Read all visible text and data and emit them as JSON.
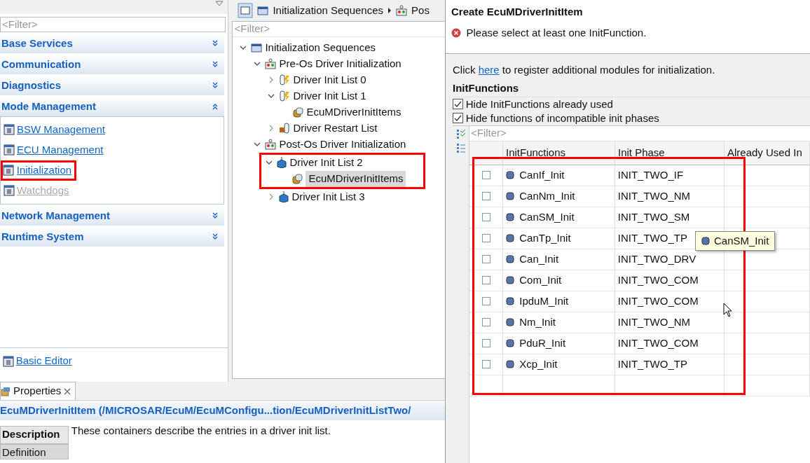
{
  "left_panel": {
    "filter_placeholder": "<Filter>",
    "sections": [
      {
        "label": "Base Services",
        "expanded": false
      },
      {
        "label": "Communication",
        "expanded": false
      },
      {
        "label": "Diagnostics",
        "expanded": false
      },
      {
        "label": "Mode Management",
        "expanded": true,
        "items": [
          {
            "label": "BSW Management",
            "disabled": false,
            "annotated": false
          },
          {
            "label": "ECU Management",
            "disabled": false,
            "annotated": false
          },
          {
            "label": "Initialization",
            "disabled": false,
            "annotated": true
          },
          {
            "label": "Watchdogs",
            "disabled": true,
            "annotated": false
          }
        ]
      },
      {
        "label": "Network Management",
        "expanded": false
      },
      {
        "label": "Runtime System",
        "expanded": false
      }
    ],
    "footer_link": "Basic Editor"
  },
  "editor": {
    "breadcrumb": [
      "Initialization Sequences",
      "Pos"
    ],
    "filter_placeholder": "<Filter>",
    "tree": [
      {
        "label": "Initialization Sequences",
        "kind": "folder",
        "expanded": true,
        "selected": false,
        "annotated": false,
        "children": [
          {
            "label": "Pre-Os Driver Initialization",
            "kind": "phase",
            "expanded": true,
            "selected": false,
            "annotated": false,
            "children": [
              {
                "label": "Driver Init List 0",
                "kind": "list",
                "expanded": false,
                "selected": false,
                "annotated": false
              },
              {
                "label": "Driver Init List 1",
                "kind": "list",
                "expanded": true,
                "selected": false,
                "annotated": false,
                "children": [
                  {
                    "label": "EcuMDriverInitItems",
                    "kind": "items",
                    "selected": false,
                    "annotated": false
                  }
                ]
              },
              {
                "label": "Driver Restart List",
                "kind": "restart",
                "expanded": false,
                "selected": false,
                "annotated": false
              }
            ]
          },
          {
            "label": "Post-Os Driver Initialization",
            "kind": "phase",
            "expanded": true,
            "selected": false,
            "annotated": false,
            "children": [
              {
                "label": "Driver Init List 2",
                "kind": "cube",
                "expanded": true,
                "selected": false,
                "annotated": true,
                "children": [
                  {
                    "label": "EcuMDriverInitItems",
                    "kind": "items",
                    "selected": true,
                    "annotated": false
                  }
                ]
              },
              {
                "label": "Driver Init List 3",
                "kind": "cube",
                "expanded": false,
                "selected": false,
                "annotated": false
              }
            ]
          }
        ]
      }
    ]
  },
  "properties": {
    "tab": "Properties",
    "title": "EcuMDriverInitItem (/MICROSAR/EcuM/EcuMConfigu...tion/EcuMDriverInitListTwo/",
    "side_tabs": [
      {
        "label": "Description",
        "selected": true
      },
      {
        "label": "Definition",
        "selected": false
      }
    ],
    "description": "These containers describe the entries in a driver init list."
  },
  "dialog": {
    "title": "Create EcuMDriverInitItem",
    "error": "Please select at least one InitFunction.",
    "register_pre": "Click",
    "register_link": "here",
    "register_post": "to register additional modules for initialization.",
    "section": "InitFunctions",
    "options": [
      {
        "label": "Hide InitFunctions already used",
        "checked": true
      },
      {
        "label": "Hide functions of incompatible init phases",
        "checked": true
      }
    ],
    "filter_placeholder": "<Filter>",
    "columns": [
      "InitFunctions",
      "Init Phase",
      "Already Used In"
    ],
    "annotated": true,
    "rows": [
      {
        "name": "CanIf_Init",
        "phase": "INIT_TWO_IF",
        "checked": false
      },
      {
        "name": "CanNm_Init",
        "phase": "INIT_TWO_NM",
        "checked": false
      },
      {
        "name": "CanSM_Init",
        "phase": "INIT_TWO_SM",
        "checked": false
      },
      {
        "name": "CanTp_Init",
        "phase": "INIT_TWO_TP",
        "checked": false
      },
      {
        "name": "Can_Init",
        "phase": "INIT_TWO_DRV",
        "checked": false
      },
      {
        "name": "Com_Init",
        "phase": "INIT_TWO_COM",
        "checked": false
      },
      {
        "name": "IpduM_Init",
        "phase": "INIT_TWO_COM",
        "checked": false
      },
      {
        "name": "Nm_Init",
        "phase": "INIT_TWO_NM",
        "checked": false
      },
      {
        "name": "PduR_Init",
        "phase": "INIT_TWO_COM",
        "checked": false
      },
      {
        "name": "Xcp_Init",
        "phase": "INIT_TWO_TP",
        "checked": false
      }
    ],
    "tooltip": "CanSM_Init"
  }
}
